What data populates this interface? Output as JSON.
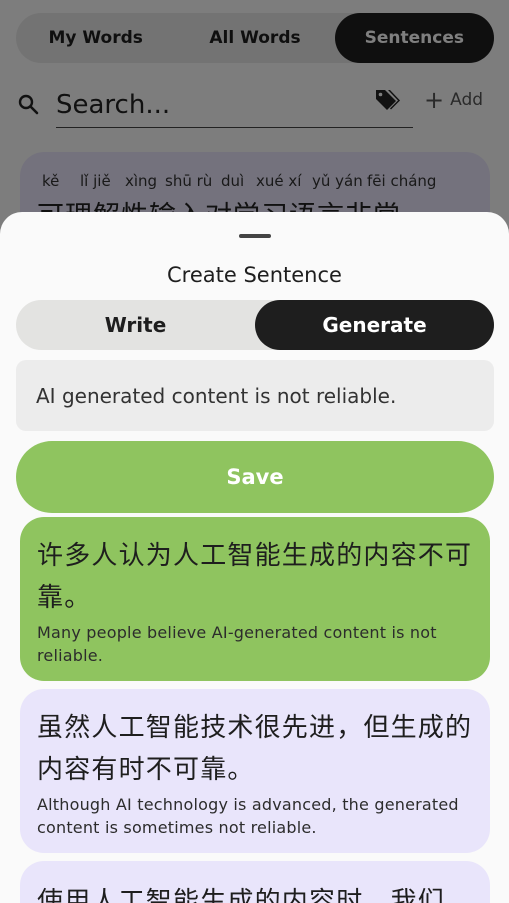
{
  "top_tabs": {
    "my_words": "My Words",
    "all_words": "All Words",
    "sentences": "Sentences"
  },
  "search": {
    "placeholder": "Search...",
    "add_label": "Add"
  },
  "background_card": {
    "pinyin": [
      "kě",
      "lǐ jiě",
      "xìng",
      "shū rù",
      "duì",
      "xué xí",
      "yǔ yán",
      "fēi cháng"
    ],
    "hanzi": "可理解性输入对学习语言非常"
  },
  "sheet": {
    "title": "Create Sentence",
    "mode_write": "Write",
    "mode_generate": "Generate",
    "notice": "AI generated content is not reliable.",
    "save_label": "Save",
    "sentences": [
      {
        "zh": "许多人认为人工智能生成的内容不可靠。",
        "en": "Many people believe AI-generated content is not reliable.",
        "color": "#8fc45f"
      },
      {
        "zh": "虽然人工智能技术很先进，但生成的内容有时不可靠。",
        "en": "Although AI technology is advanced, the generated content is sometimes not reliable.",
        "color": "#e9e5fb"
      },
      {
        "zh": "使用人工智能生成的内容时，我们",
        "en": "",
        "color": "#e9e5fb"
      }
    ]
  },
  "icons": {
    "search": "search-icon",
    "tag": "tags-icon",
    "add": "plus-icon"
  },
  "colors": {
    "accent_green": "#8fc45f",
    "lavender": "#e9e5fb",
    "dark": "#1e1e1e"
  }
}
